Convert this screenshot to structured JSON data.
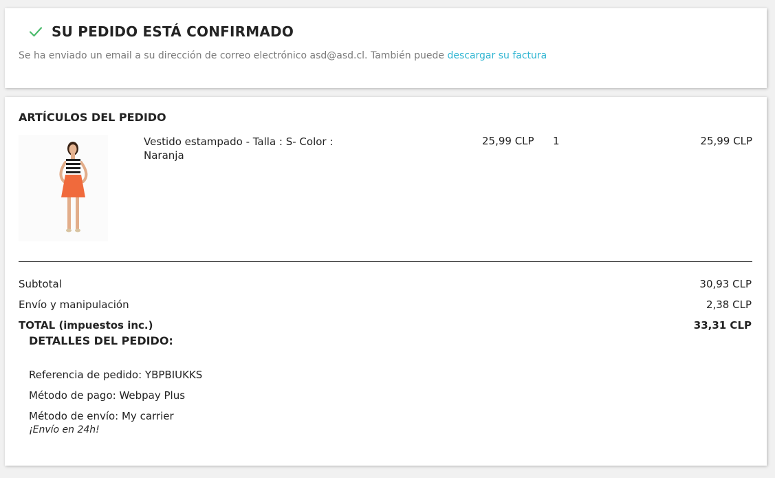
{
  "confirmation": {
    "title": "SU PEDIDO ESTÁ CONFIRMADO",
    "message": "Se ha enviado un email a su dirección de correo electrónico asd@asd.cl. También puede ",
    "invoice_link": "descargar su factura",
    "check_icon": "check-icon",
    "check_color": "#4cbb6c",
    "link_color": "#2fb5d2"
  },
  "order_items": {
    "title": "ARTÍCULOS DEL PEDIDO",
    "items": [
      {
        "name": "Vestido estampado - Talla : S- Color : Naranja",
        "unit_price": "25,99 CLP",
        "quantity": "1",
        "total": "25,99 CLP"
      }
    ]
  },
  "totals": {
    "subtotal_label": "Subtotal",
    "subtotal_value": "30,93 CLP",
    "shipping_label": "Envío y manipulación",
    "shipping_value": "2,38 CLP",
    "total_label": "TOTAL (impuestos inc.)",
    "total_value": "33,31 CLP"
  },
  "details": {
    "title": "DETALLES DEL PEDIDO:",
    "reference": "Referencia de pedido: YBPBIUKKS",
    "payment": "Método de pago: Webpay Plus",
    "shipping": "Método de envío: My carrier",
    "shipping_note": "¡Envío en 24h!"
  }
}
